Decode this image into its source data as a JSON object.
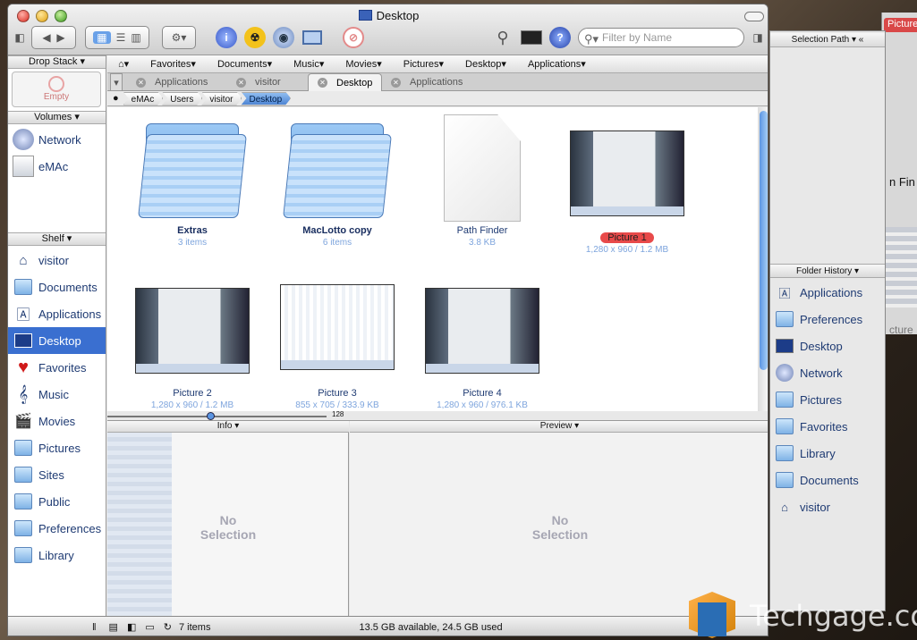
{
  "window": {
    "title": "Desktop"
  },
  "toolbar": {
    "search_placeholder": "Filter by Name"
  },
  "left": {
    "drop_stack_label": "Drop Stack",
    "drop_stack_empty": "Empty",
    "volumes_label": "Volumes",
    "volumes": [
      "Network",
      "eMAc"
    ],
    "shelf_label": "Shelf",
    "shelf": [
      "visitor",
      "Documents",
      "Applications",
      "Desktop",
      "Favorites",
      "Music",
      "Movies",
      "Pictures",
      "Sites",
      "Public",
      "Preferences",
      "Library"
    ]
  },
  "menubar": {
    "items": [
      "Favorites",
      "Documents",
      "Music",
      "Movies",
      "Pictures",
      "Desktop",
      "Applications"
    ]
  },
  "tabs": [
    "Applications",
    "visitor",
    "Desktop",
    "Applications"
  ],
  "breadcrumb": [
    "eMAc",
    "Users",
    "visitor",
    "Desktop"
  ],
  "items": [
    {
      "name": "Extras",
      "sub": "3 items"
    },
    {
      "name": "MacLotto copy",
      "sub": "6 items"
    },
    {
      "name": "Path Finder",
      "sub": "3.8 KB"
    },
    {
      "name": "Picture 1",
      "sub": "1,280 x 960 / 1.2 MB"
    },
    {
      "name": "Picture 2",
      "sub": "1,280 x 960 / 1.2 MB"
    },
    {
      "name": "Picture 3",
      "sub": "855 x 705 / 333.9 KB"
    },
    {
      "name": "Picture 4",
      "sub": "1,280 x 960 / 976.1 KB"
    }
  ],
  "slider": {
    "value": "128"
  },
  "panels": {
    "info_label": "Info",
    "preview_label": "Preview",
    "no_selection_1": "No",
    "no_selection_2": "Selection"
  },
  "status": {
    "count": "7 items",
    "space": "13.5 GB available, 24.5 GB used"
  },
  "right": {
    "selection_path_label": "Selection Path",
    "folder_history_label": "Folder History",
    "history": [
      "Applications",
      "Preferences",
      "Desktop",
      "Network",
      "Pictures",
      "Favorites",
      "Library",
      "Documents",
      "visitor"
    ]
  },
  "background": {
    "pill": "Picture",
    "text1": "n Fin",
    "text2": "cture"
  },
  "watermark": {
    "text": "Techgage.com"
  }
}
